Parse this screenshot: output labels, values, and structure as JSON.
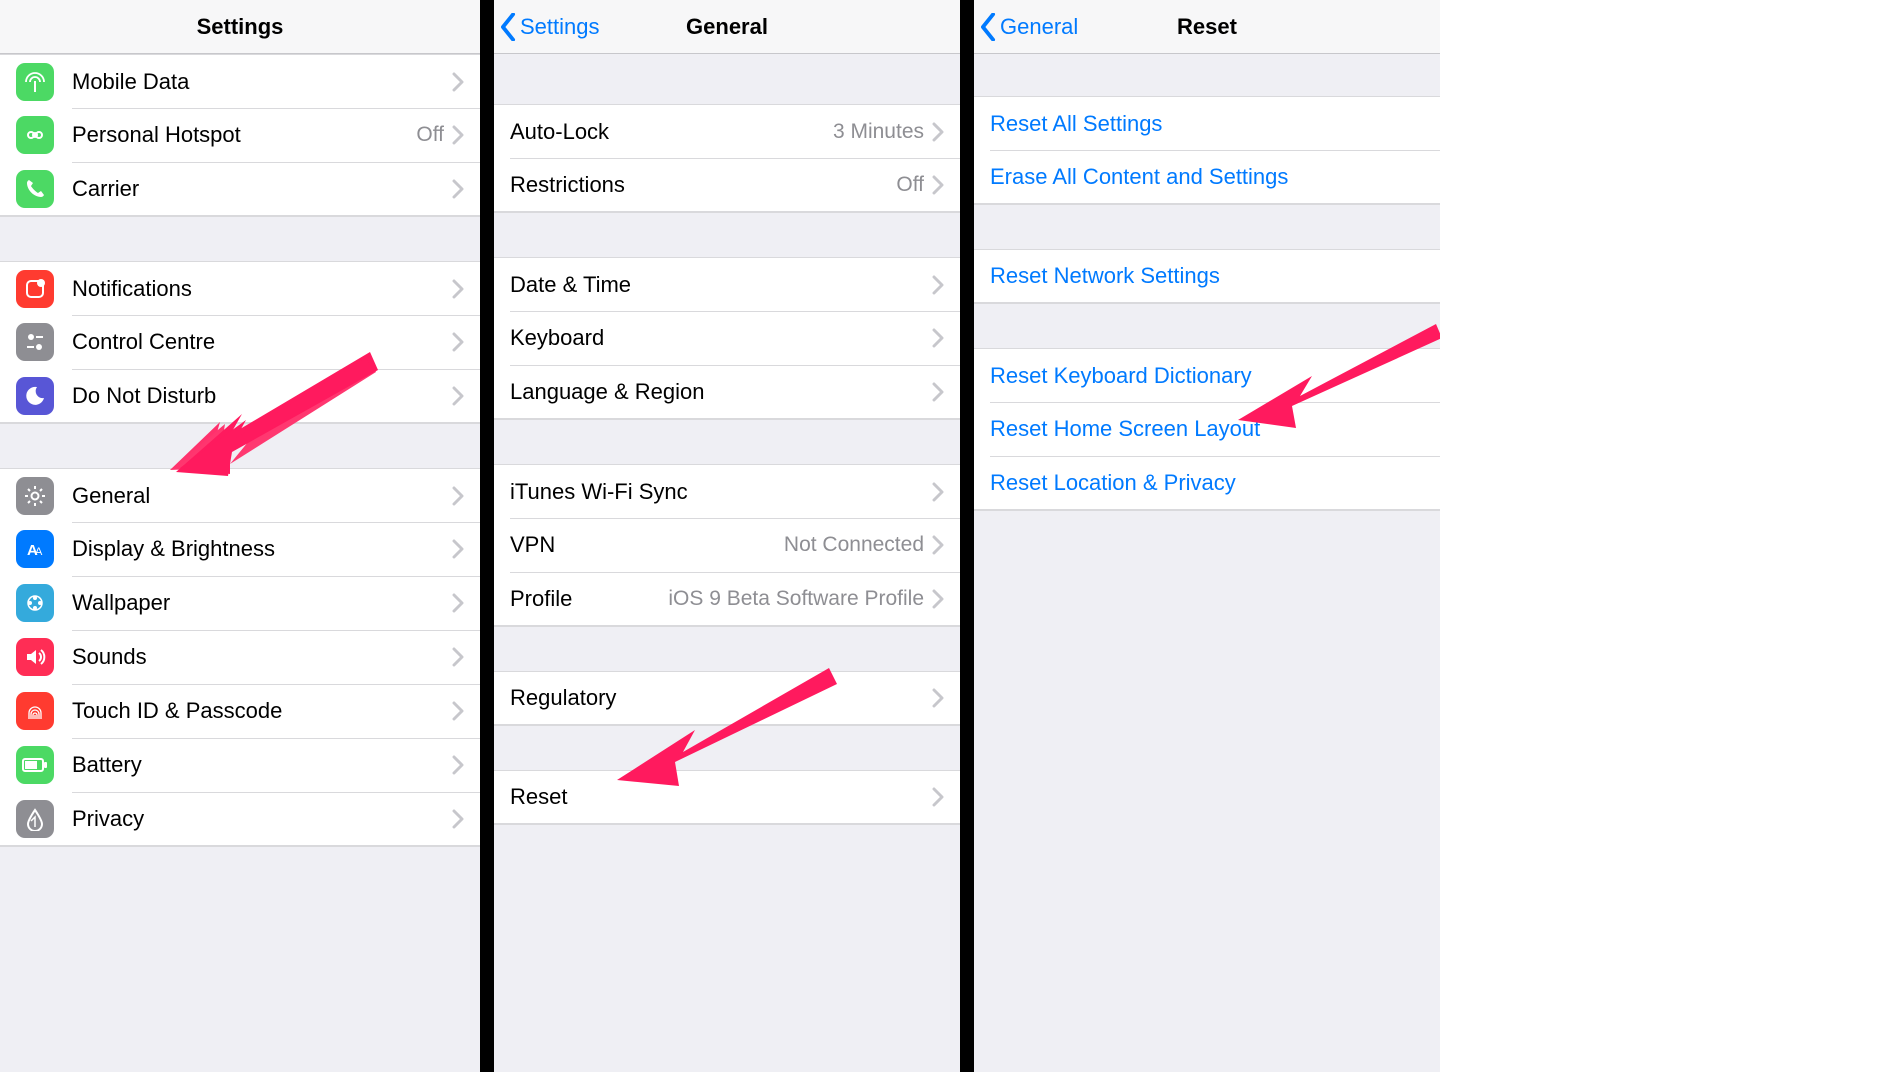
{
  "panel1": {
    "title": "Settings",
    "groups": [
      {
        "icons": true,
        "rows": [
          {
            "icon": {
              "bg": "#4cd964",
              "name": "antenna-icon"
            },
            "label": "Mobile Data",
            "value": "",
            "chevron": true,
            "name": "row-mobile-data"
          },
          {
            "icon": {
              "bg": "#4cd964",
              "name": "hotspot-icon"
            },
            "label": "Personal Hotspot",
            "value": "Off",
            "chevron": true,
            "name": "row-personal-hotspot"
          },
          {
            "icon": {
              "bg": "#4cd964",
              "name": "phone-icon"
            },
            "label": "Carrier",
            "value": "",
            "chevron": true,
            "name": "row-carrier"
          }
        ]
      },
      {
        "icons": true,
        "rows": [
          {
            "icon": {
              "bg": "#ff3b30",
              "name": "notifications-icon"
            },
            "label": "Notifications",
            "value": "",
            "chevron": true,
            "name": "row-notifications"
          },
          {
            "icon": {
              "bg": "#8e8e93",
              "name": "control-centre-icon"
            },
            "label": "Control Centre",
            "value": "",
            "chevron": true,
            "name": "row-control-centre"
          },
          {
            "icon": {
              "bg": "#5856d6",
              "name": "moon-icon"
            },
            "label": "Do Not Disturb",
            "value": "",
            "chevron": true,
            "name": "row-do-not-disturb"
          }
        ]
      },
      {
        "icons": true,
        "rows": [
          {
            "icon": {
              "bg": "#8e8e93",
              "name": "gear-icon"
            },
            "label": "General",
            "value": "",
            "chevron": true,
            "name": "row-general"
          },
          {
            "icon": {
              "bg": "#007aff",
              "name": "display-icon"
            },
            "label": "Display & Brightness",
            "value": "",
            "chevron": true,
            "name": "row-display-brightness"
          },
          {
            "icon": {
              "bg": "#34aadc",
              "name": "wallpaper-icon"
            },
            "label": "Wallpaper",
            "value": "",
            "chevron": true,
            "name": "row-wallpaper"
          },
          {
            "icon": {
              "bg": "#ff2d55",
              "name": "sounds-icon"
            },
            "label": "Sounds",
            "value": "",
            "chevron": true,
            "name": "row-sounds"
          },
          {
            "icon": {
              "bg": "#ff3b30",
              "name": "touchid-icon"
            },
            "label": "Touch ID & Passcode",
            "value": "",
            "chevron": true,
            "name": "row-touchid-passcode"
          },
          {
            "icon": {
              "bg": "#4cd964",
              "name": "battery-icon"
            },
            "label": "Battery",
            "value": "",
            "chevron": true,
            "name": "row-battery"
          },
          {
            "icon": {
              "bg": "#8e8e93",
              "name": "privacy-icon"
            },
            "label": "Privacy",
            "value": "",
            "chevron": true,
            "name": "row-privacy"
          }
        ]
      }
    ]
  },
  "panel2": {
    "title": "General",
    "back": "Settings",
    "groups": [
      {
        "rows": [
          {
            "label": "Auto-Lock",
            "value": "3 Minutes",
            "chevron": true,
            "name": "row-auto-lock"
          },
          {
            "label": "Restrictions",
            "value": "Off",
            "chevron": true,
            "name": "row-restrictions"
          }
        ]
      },
      {
        "rows": [
          {
            "label": "Date & Time",
            "value": "",
            "chevron": true,
            "name": "row-date-time"
          },
          {
            "label": "Keyboard",
            "value": "",
            "chevron": true,
            "name": "row-keyboard"
          },
          {
            "label": "Language & Region",
            "value": "",
            "chevron": true,
            "name": "row-language-region"
          }
        ]
      },
      {
        "rows": [
          {
            "label": "iTunes Wi-Fi Sync",
            "value": "",
            "chevron": true,
            "name": "row-itunes-wifi-sync"
          },
          {
            "label": "VPN",
            "value": "Not Connected",
            "chevron": true,
            "name": "row-vpn"
          },
          {
            "label": "Profile",
            "value": "iOS 9 Beta Software Profile",
            "chevron": true,
            "name": "row-profile"
          }
        ]
      },
      {
        "rows": [
          {
            "label": "Regulatory",
            "value": "",
            "chevron": true,
            "name": "row-regulatory"
          }
        ]
      },
      {
        "rows": [
          {
            "label": "Reset",
            "value": "",
            "chevron": true,
            "name": "row-reset"
          }
        ]
      }
    ]
  },
  "panel3": {
    "title": "Reset",
    "back": "General",
    "groups": [
      {
        "rows": [
          {
            "label": "Reset All Settings",
            "blue": true,
            "name": "row-reset-all-settings"
          },
          {
            "label": "Erase All Content and Settings",
            "blue": true,
            "name": "row-erase-all"
          }
        ]
      },
      {
        "rows": [
          {
            "label": "Reset Network Settings",
            "blue": true,
            "name": "row-reset-network"
          }
        ]
      },
      {
        "rows": [
          {
            "label": "Reset Keyboard Dictionary",
            "blue": true,
            "name": "row-reset-keyboard-dictionary"
          },
          {
            "label": "Reset Home Screen Layout",
            "blue": true,
            "name": "row-reset-home-screen-layout"
          },
          {
            "label": "Reset Location & Privacy",
            "blue": true,
            "name": "row-reset-location-privacy"
          }
        ]
      }
    ]
  }
}
